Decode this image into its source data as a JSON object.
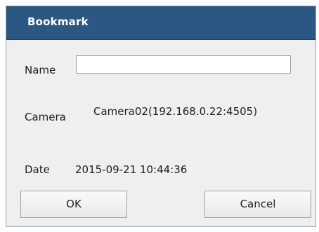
{
  "dialog": {
    "title": "Bookmark"
  },
  "fields": {
    "name_label": "Name",
    "name_value": "",
    "camera_label": "Camera",
    "camera_value": "Camera02(192.168.0.22:4505)",
    "date_label": "Date",
    "date_value": "2015-09-21 10:44:36"
  },
  "buttons": {
    "ok_label": "OK",
    "cancel_label": "Cancel"
  },
  "colors": {
    "titlebar": "#2c5783",
    "dialog_bg": "#efefef"
  }
}
